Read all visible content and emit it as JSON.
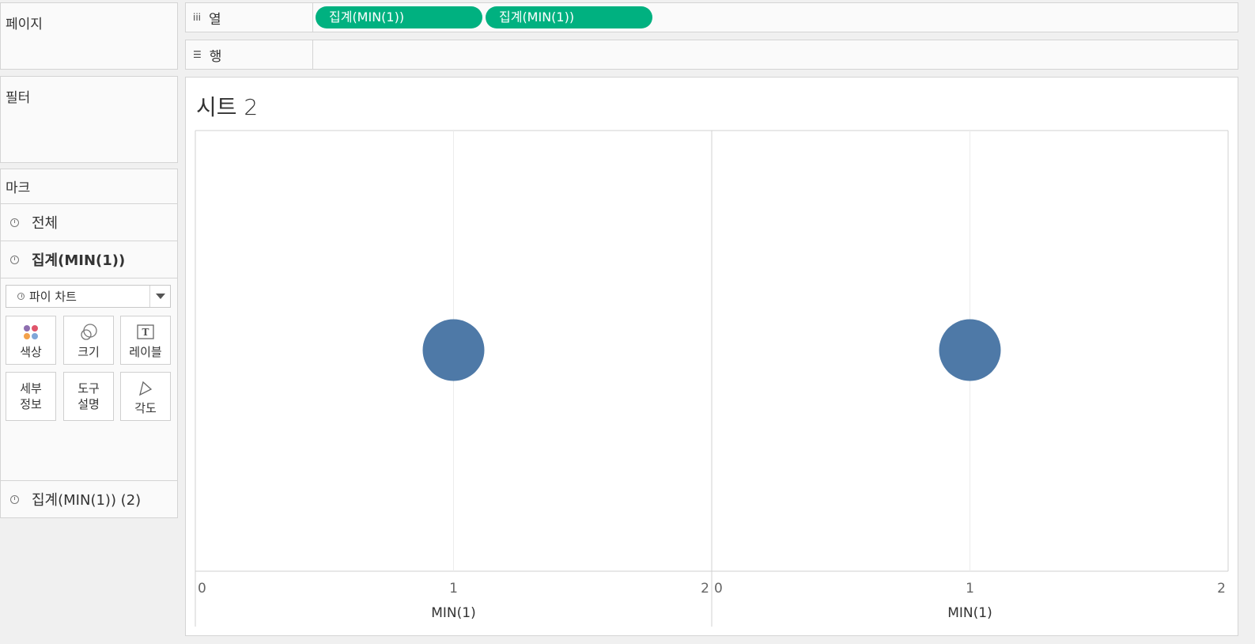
{
  "pages_panel": {
    "title": "페이지"
  },
  "filters_panel": {
    "title": "필터"
  },
  "columns_shelf": {
    "label": "열",
    "icon": "columns-icon",
    "pills": [
      "집계(MIN(1))",
      "집계(MIN(1))"
    ]
  },
  "rows_shelf": {
    "label": "행",
    "icon": "rows-icon"
  },
  "marks": {
    "title": "마크",
    "all_label": "전체",
    "card1_label": "집계(MIN(1))",
    "mark_type": "파이 차트",
    "cards": {
      "color": "색상",
      "size": "크기",
      "label": "레이블",
      "detail_1": "세부",
      "detail_2": "정보",
      "tooltip_1": "도구",
      "tooltip_2": "설명",
      "angle": "각도"
    },
    "card2_label": "집계(MIN(1)) (2)"
  },
  "sheet": {
    "title": "시트 2"
  },
  "colors": {
    "pill": "#00b180",
    "mark": "#4e79a7"
  },
  "chart_data": [
    {
      "type": "scatter",
      "x": [
        1
      ],
      "y": [
        null
      ],
      "xlim": [
        0,
        2
      ],
      "xticks": [
        "0",
        "1",
        "2"
      ],
      "xlabel": "MIN(1)",
      "ylabel": "",
      "mark": "pie",
      "grid": true
    },
    {
      "type": "scatter",
      "x": [
        1
      ],
      "y": [
        null
      ],
      "xlim": [
        0,
        2
      ],
      "xticks": [
        "0",
        "1",
        "2"
      ],
      "xlabel": "MIN(1)",
      "ylabel": "",
      "mark": "pie",
      "grid": true
    }
  ]
}
